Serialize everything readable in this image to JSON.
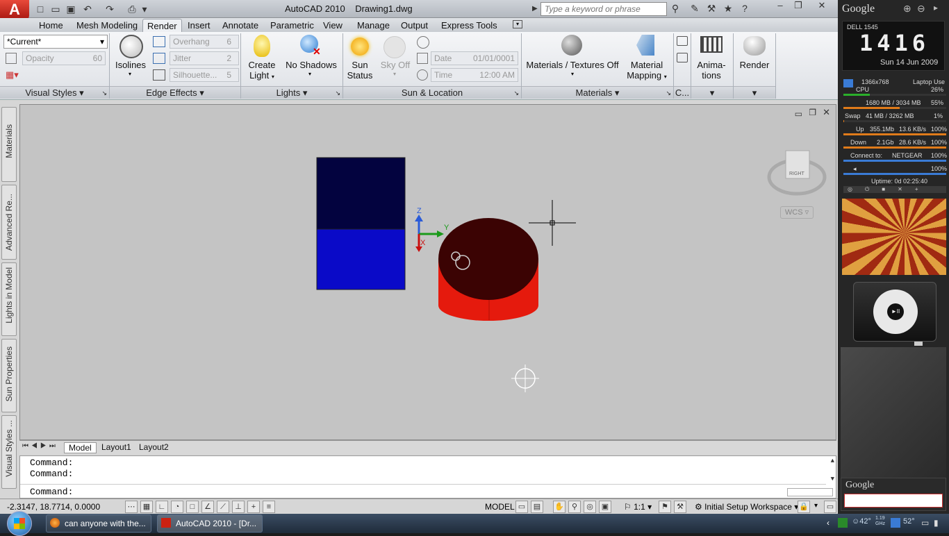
{
  "app": {
    "title": "AutoCAD 2010",
    "document": "Drawing1.dwg"
  },
  "search": {
    "placeholder": "Type a keyword or phrase"
  },
  "tabs": [
    "Home",
    "Mesh Modeling",
    "Render",
    "Insert",
    "Annotate",
    "Parametric",
    "View",
    "Manage",
    "Output",
    "Express Tools"
  ],
  "ribbon": {
    "visual_styles": {
      "current": "*Current*",
      "opacity_label": "Opacity",
      "opacity_value": "60",
      "title": "Visual Styles"
    },
    "edge_effects": {
      "isolines": "Isolines",
      "overhang": "Overhang",
      "overhang_value": "6",
      "jitter": "Jitter",
      "jitter_value": "2",
      "silhouette": "Silhouette...",
      "silhouette_value": "5",
      "title": "Edge Effects"
    },
    "lights": {
      "create_light_1": "Create",
      "create_light_2": "Light",
      "no_shadows": "No Shadows",
      "title": "Lights"
    },
    "sun": {
      "sun_status_1": "Sun",
      "sun_status_2": "Status",
      "sky_off": "Sky Off",
      "date_label": "Date",
      "date_value": "01/01/0001",
      "time_label": "Time",
      "time_value": "12:00 AM",
      "title": "Sun & Location"
    },
    "materials": {
      "materials_textures": "Materials / Textures Off",
      "mapping_1": "Material",
      "mapping_2": "Mapping",
      "title": "Materials"
    },
    "camera": {
      "title": "C..."
    },
    "animations": {
      "l1": "Anima-",
      "l2": "tions"
    },
    "render": {
      "label": "Render"
    }
  },
  "left_panels": [
    "Materials",
    "Advanced Re...",
    "Lights in Model",
    "Sun Properties",
    "Visual Styles ..."
  ],
  "viewcube": {
    "face": "RIGHT",
    "wcs": "WCS"
  },
  "axes": {
    "x": "X",
    "y": "Y",
    "z": "Z"
  },
  "layout_tabs": [
    "Model",
    "Layout1",
    "Layout2"
  ],
  "command": {
    "line1": "Command:",
    "line2": "Command:",
    "prompt": "Command:"
  },
  "status": {
    "coords": "-2.3147, 18.7714, 0.0000",
    "model": "MODEL",
    "scale": "1:1",
    "workspace": "Initial Setup Workspace"
  },
  "sidebar": {
    "google": "Google",
    "device": "DELL 1545",
    "clock": "1416",
    "date": "Sun 14 Jun 2009",
    "resolution": "1366x768",
    "laptop_use": "Laptop Use",
    "cpu_label": "CPU",
    "cpu": "26%",
    "mem": "1680 MB / 3034 MB",
    "mem_pct": "55%",
    "swap_label": "Swap",
    "swap": "41 MB / 3262 MB",
    "swap_pct": "1%",
    "up_label": "Up",
    "up": "355.1Mb",
    "up_rate": "13.6 KB/s",
    "up_pct": "100%",
    "down_label": "Down",
    "down": "2.1Gb",
    "down_rate": "28.6 KB/s",
    "down_pct": "100%",
    "connect_label": "Connect to:",
    "network": "NETGEAR",
    "net_pct": "100%",
    "vol_pct": "100%",
    "uptime": "Uptime: 0d 02:25:40",
    "google2": "Google"
  },
  "taskbar": {
    "task1": "can anyone with the...",
    "task2": "AutoCAD 2010 - [Dr...",
    "temp1": "42°",
    "temp2": "52°",
    "cpu_ghz": "1.19 GHz"
  }
}
